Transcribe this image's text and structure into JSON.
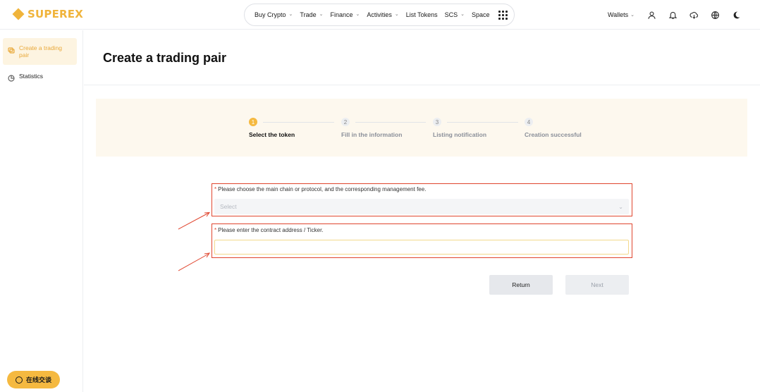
{
  "brand": {
    "name": "SUPEREX",
    "color": "#f0b43b"
  },
  "nav": {
    "items": [
      {
        "label": "Buy Crypto",
        "dropdown": true
      },
      {
        "label": "Trade",
        "dropdown": true
      },
      {
        "label": "Finance",
        "dropdown": true
      },
      {
        "label": "Activities",
        "dropdown": true
      },
      {
        "label": "List Tokens",
        "dropdown": false
      },
      {
        "label": "SCS",
        "dropdown": true
      },
      {
        "label": "Space",
        "dropdown": false
      }
    ],
    "chevron": "⌄"
  },
  "header_right": {
    "wallets_label": "Wallets",
    "icons": [
      "user-icon",
      "bell-icon",
      "download-icon",
      "globe-icon",
      "moon-icon"
    ]
  },
  "sidebar": {
    "items": [
      {
        "label": "Create a trading pair",
        "icon": "token-icon",
        "active": true
      },
      {
        "label": "Statistics",
        "icon": "pie-chart-icon",
        "active": false
      }
    ],
    "chat_label": "在线交谈"
  },
  "page": {
    "title": "Create a trading pair"
  },
  "steps": [
    {
      "number": "1",
      "label": "Select the token",
      "state": "current"
    },
    {
      "number": "2",
      "label": "Fill in the information",
      "state": "pending"
    },
    {
      "number": "3",
      "label": "Listing notification",
      "state": "pending"
    },
    {
      "number": "4",
      "label": "Creation successful",
      "state": "pending"
    }
  ],
  "form": {
    "chain_label": "Please choose the main chain or protocol, and the corresponding management fee.",
    "chain_placeholder": "Select",
    "contract_label": "Please enter the contract address / Ticker.",
    "contract_value": "",
    "required_mark": "*"
  },
  "buttons": {
    "return_label": "Return",
    "next_label": "Next"
  },
  "colors": {
    "accent": "#f5b940",
    "annotation": "#e0452e",
    "steps_bg": "#fdf8ee"
  }
}
